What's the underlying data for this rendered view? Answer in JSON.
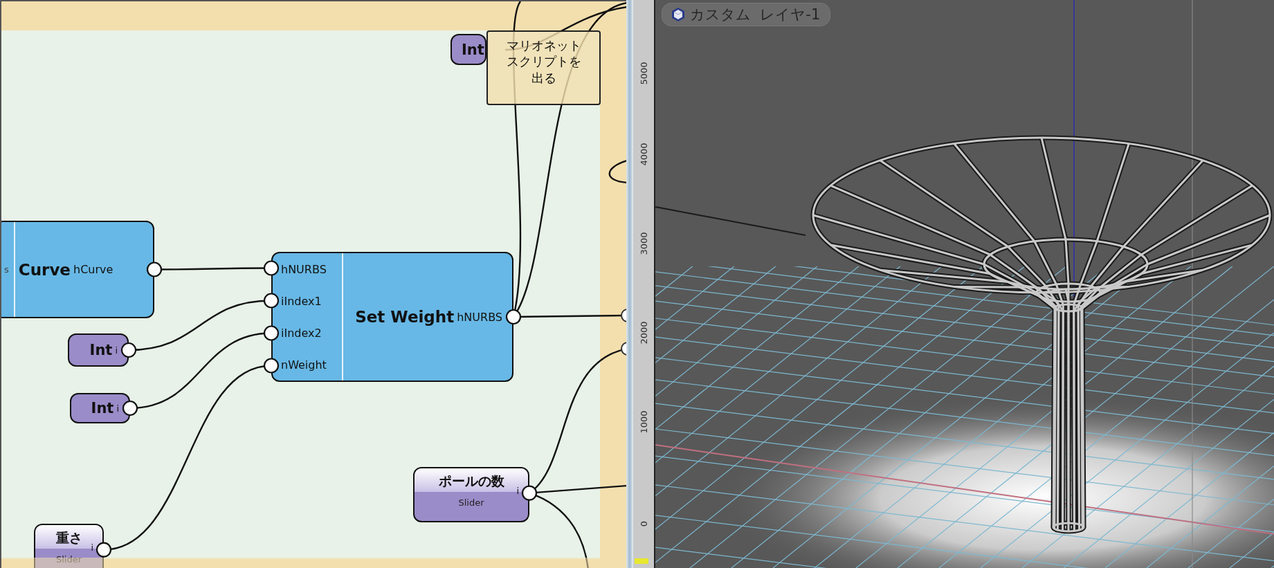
{
  "node_editor": {
    "nodes": [
      {
        "kind": "function",
        "title": "Curve",
        "cut_prefix": "s",
        "outputs": [
          "hCurve"
        ]
      },
      {
        "kind": "function",
        "title": "Set Weight",
        "inputs": [
          "hNURBS",
          "iIndex1",
          "iIndex2",
          "nWeight"
        ],
        "outputs": [
          "hNURBS"
        ]
      },
      {
        "kind": "int",
        "title": "Int",
        "outputs": [
          "i"
        ]
      },
      {
        "kind": "int",
        "title": "Int",
        "outputs": [
          "i"
        ]
      },
      {
        "kind": "int",
        "title": "Int"
      },
      {
        "kind": "slider",
        "title": "ポールの数",
        "subtitle": "Slider",
        "outputs": [
          "i"
        ]
      },
      {
        "kind": "slider",
        "title": "重さ",
        "subtitle": "Slider",
        "outputs": [
          "i"
        ]
      }
    ],
    "comment": "マリオネットスクリプトを出る"
  },
  "ruler": {
    "labels": [
      "5000",
      "4000",
      "3000",
      "2000",
      "1000",
      "0"
    ]
  },
  "viewport": {
    "layer_label": "カスタム  レイヤ-1"
  }
}
